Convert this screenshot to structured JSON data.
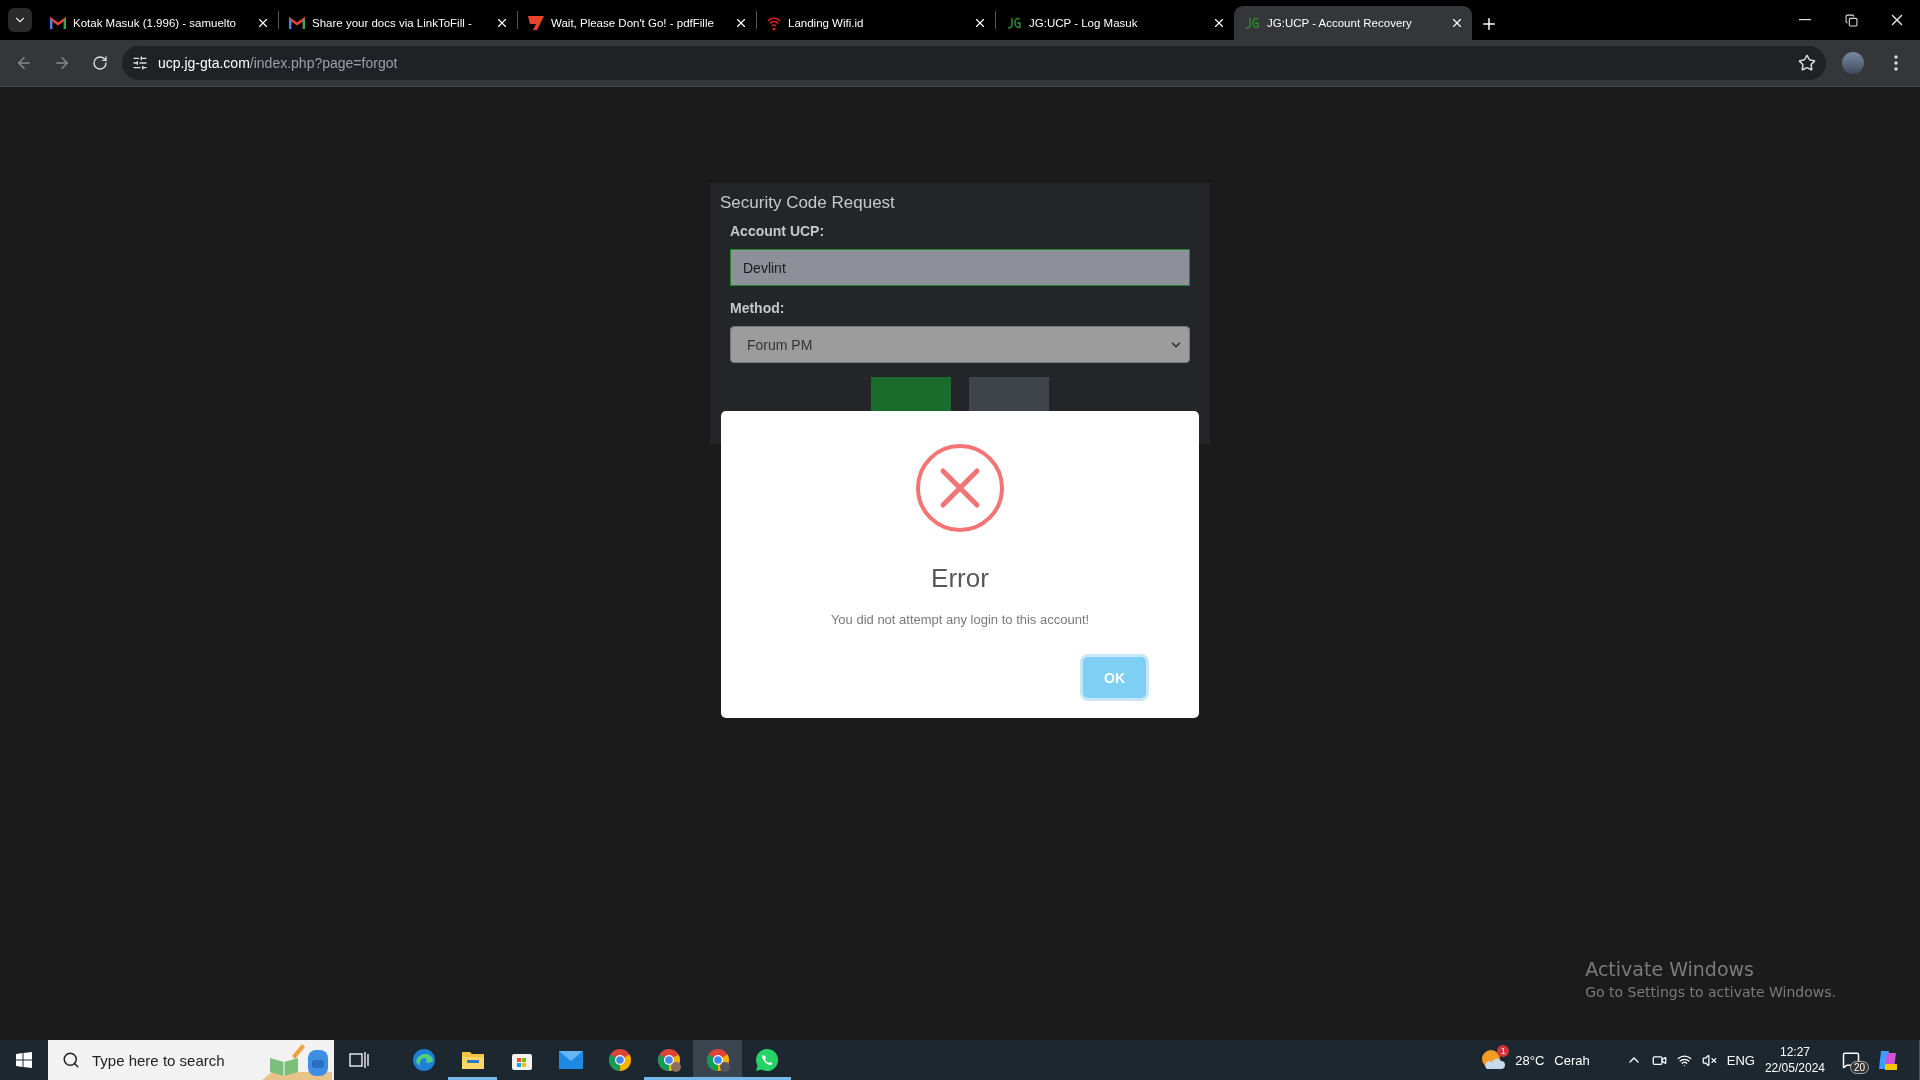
{
  "browser": {
    "tabs": [
      {
        "title": "Kotak Masuk (1.996) - samuelto",
        "kind": "gmail",
        "selected": false
      },
      {
        "title": "Share your docs via LinkToFill - ",
        "kind": "gmail",
        "selected": false
      },
      {
        "title": "Wait, Please Don't Go! - pdfFille",
        "kind": "pdffiller",
        "selected": false
      },
      {
        "title": "Landing Wifi.id",
        "kind": "wifi",
        "selected": false
      },
      {
        "title": "JG:UCP - Log Masuk",
        "kind": "jg",
        "selected": false
      },
      {
        "title": "JG:UCP - Account Recovery",
        "kind": "jg",
        "selected": true
      }
    ],
    "url": {
      "host": "ucp.jg-gta.com",
      "path": "/index.php?page=forgot"
    }
  },
  "form": {
    "title": "Security Code Request",
    "fields": [
      {
        "label": "Account UCP:",
        "kind": "text",
        "value": "Devlint",
        "focused": true
      },
      {
        "label": "Method:",
        "kind": "select",
        "value": "Forum PM",
        "focused": false
      }
    ],
    "buttons": [
      {
        "kind": "primary"
      },
      {
        "kind": "secondary"
      }
    ]
  },
  "dialog": {
    "title": "Error",
    "message": "You did not attempt any login to this account!",
    "button": "OK"
  },
  "activation": {
    "title": "Activate Windows",
    "message": "Go to Settings to activate Windows."
  },
  "taskbar": {
    "search": {
      "placeholder": "Type here to search"
    },
    "apps": [
      {
        "kind": "edge",
        "running": false,
        "active": false
      },
      {
        "kind": "explorer",
        "running": true,
        "active": false
      },
      {
        "kind": "store",
        "running": false,
        "active": false
      },
      {
        "kind": "mail",
        "running": false,
        "active": false
      },
      {
        "kind": "chrome",
        "running": false,
        "active": false
      },
      {
        "kind": "chrome-profile",
        "running": true,
        "active": false
      },
      {
        "kind": "chrome-group",
        "running": true,
        "active": true
      },
      {
        "kind": "whatsapp",
        "running": true,
        "active": false
      }
    ],
    "weather": {
      "badge": "1",
      "temperature": "28°C",
      "condition": "Cerah"
    },
    "language": "ENG",
    "time": "12:27",
    "date": "22/05/2024",
    "notifications": "20"
  }
}
